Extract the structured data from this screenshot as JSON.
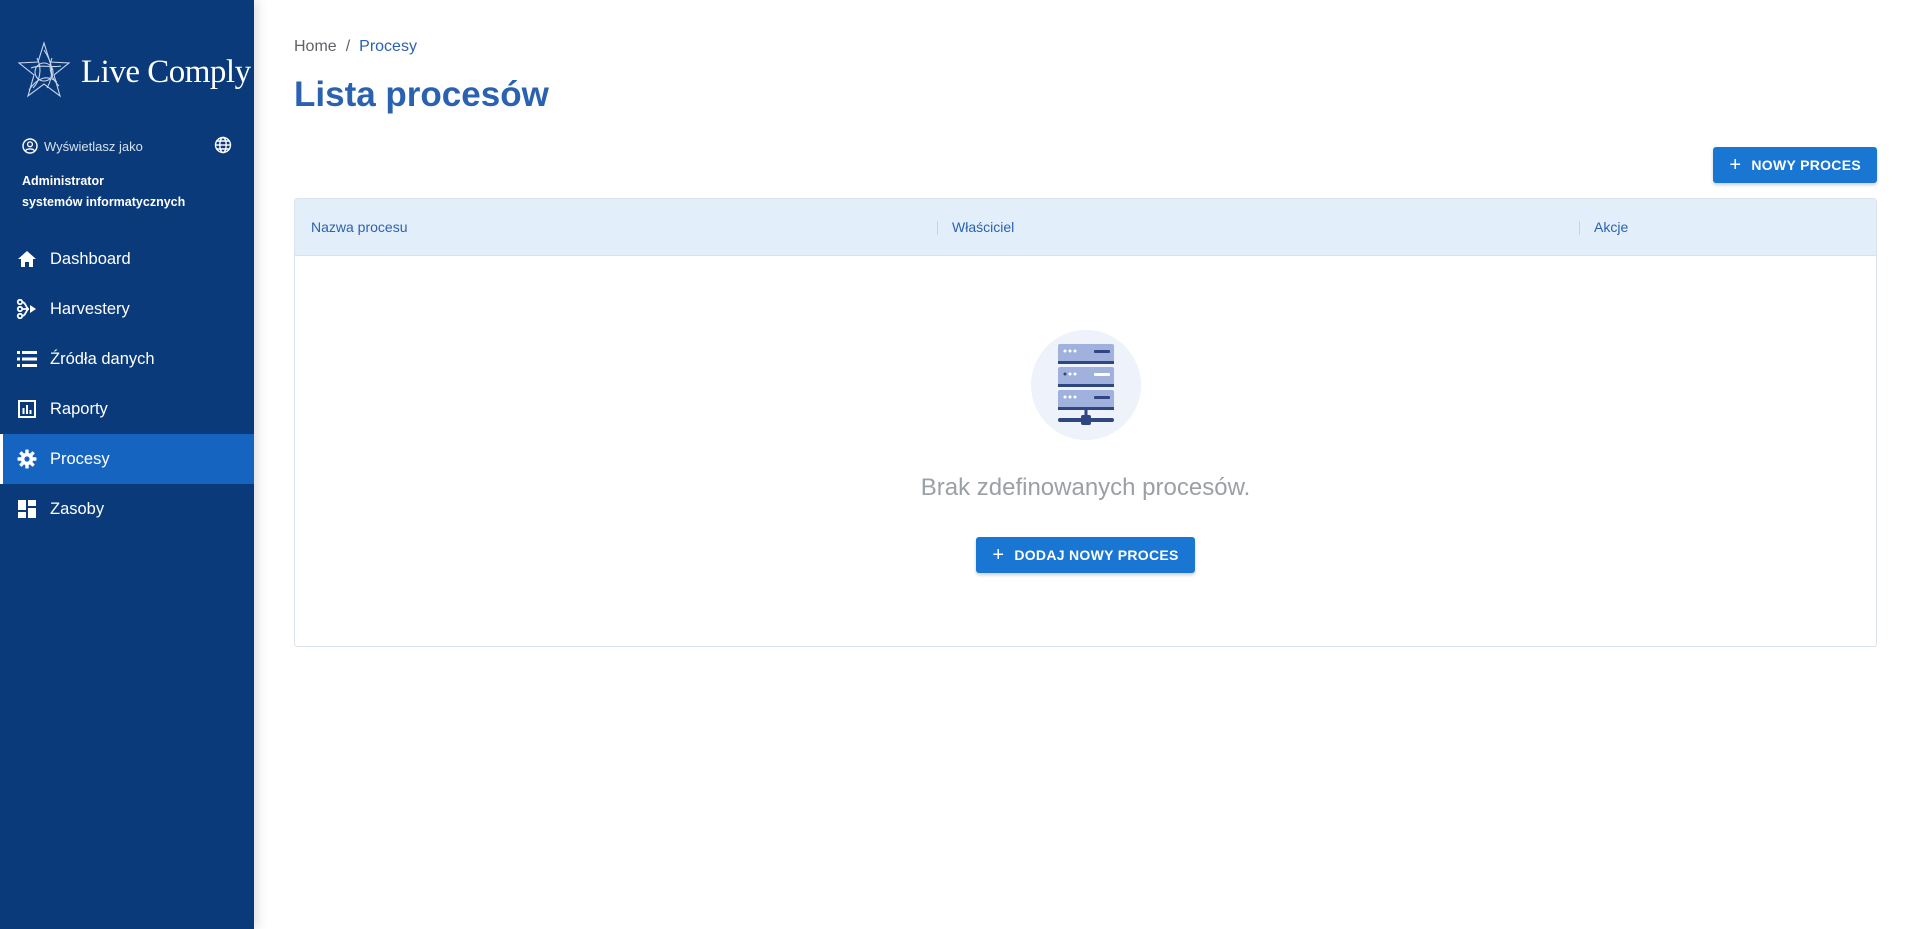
{
  "brand": {
    "name": "Live Comply"
  },
  "sidebar": {
    "viewing_as_label": "Wyświetlasz jako",
    "role_line1": "Administrator",
    "role_line2": "systemów informatycznych",
    "items": [
      {
        "label": "Dashboard",
        "icon": "home-icon"
      },
      {
        "label": "Harvestery",
        "icon": "harvester-icon"
      },
      {
        "label": "Źródła danych",
        "icon": "list-icon"
      },
      {
        "label": "Raporty",
        "icon": "report-chart-icon"
      },
      {
        "label": "Procesy",
        "icon": "gear-icon",
        "active": true
      },
      {
        "label": "Zasoby",
        "icon": "dashboard-grid-icon"
      }
    ]
  },
  "breadcrumb": {
    "home": "Home",
    "separator": "/",
    "current": "Procesy"
  },
  "page": {
    "title": "Lista procesów"
  },
  "toolbar": {
    "new_process_label": "NOWY PROCES"
  },
  "table": {
    "columns": [
      "Nazwa procesu",
      "Właściciel",
      "Akcje"
    ],
    "empty_message": "Brak zdefinowanych procesów.",
    "add_label": "DODAJ NOWY PROCES"
  },
  "colors": {
    "sidebar_bg": "#0b3a7a",
    "active_item": "#1565c0",
    "accent": "#2b62b0",
    "button": "#1976d2",
    "table_header_bg": "#e3eefb"
  }
}
